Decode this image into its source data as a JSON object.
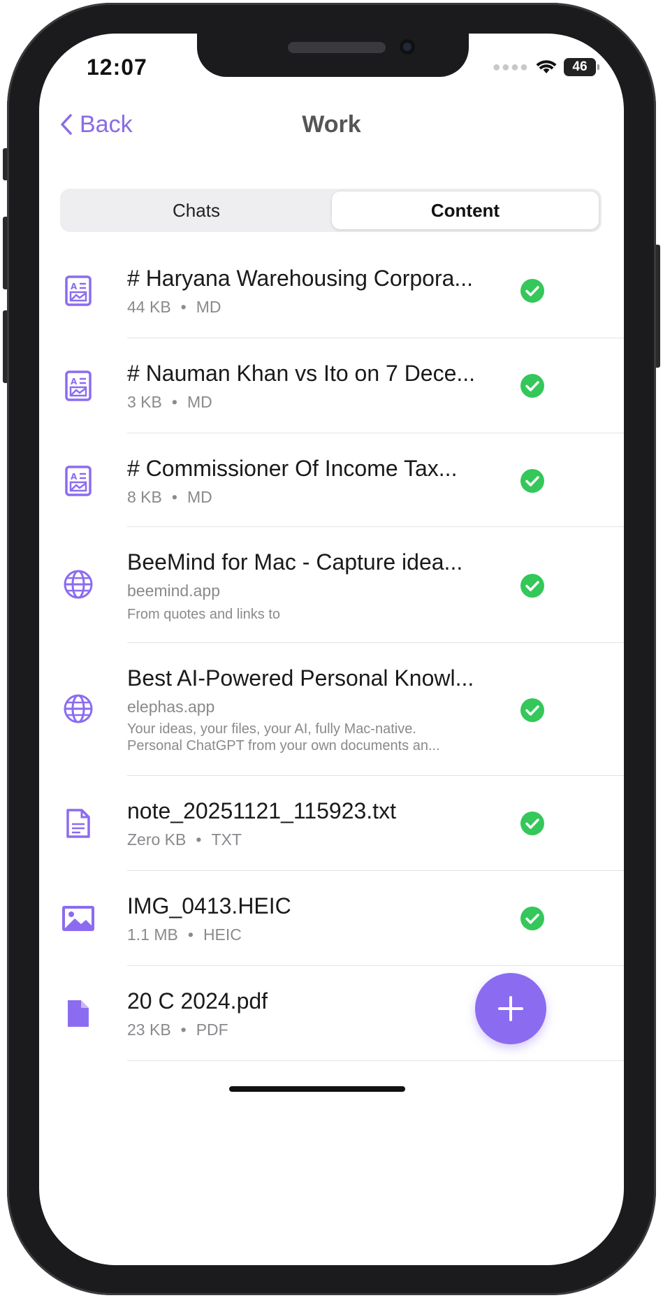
{
  "status_bar": {
    "time": "12:07",
    "battery": "46"
  },
  "nav": {
    "back_label": "Back",
    "title": "Work"
  },
  "segments": {
    "left": "Chats",
    "right": "Content",
    "selected": "Content"
  },
  "accent_color": "#8b6cf0",
  "success_color": "#34c759",
  "items": [
    {
      "icon": "markdown-doc-icon",
      "title": "# Haryana Warehousing Corpora...",
      "size": "44 KB",
      "type": "MD",
      "status": "synced"
    },
    {
      "icon": "markdown-doc-icon",
      "title": "# Nauman Khan vs Ito on 7 Dece...",
      "size": "3 KB",
      "type": "MD",
      "status": "synced"
    },
    {
      "icon": "markdown-doc-icon",
      "title": "# Commissioner Of Income Tax...",
      "size": "8 KB",
      "type": "MD",
      "status": "synced"
    },
    {
      "icon": "globe-icon",
      "title": "BeeMind for Mac - Capture idea...",
      "domain": "beemind.app",
      "desc1": "From quotes and links to",
      "status": "synced"
    },
    {
      "icon": "globe-icon",
      "title": "Best AI-Powered Personal Knowl...",
      "domain": "elephas.app",
      "desc1": "Your ideas, your files, your AI, fully Mac-native.",
      "desc2": "Personal ChatGPT from your own documents an...",
      "status": "synced"
    },
    {
      "icon": "text-file-icon",
      "title": "note_20251121_115923.txt",
      "size": "Zero KB",
      "type": "TXT",
      "status": "synced"
    },
    {
      "icon": "image-icon",
      "title": "IMG_0413.HEIC",
      "size": "1.1 MB",
      "type": "HEIC",
      "status": "synced"
    },
    {
      "icon": "pdf-file-icon",
      "title": "20 C 2024.pdf",
      "size": "23 KB",
      "type": "PDF",
      "status": "pending"
    }
  ]
}
